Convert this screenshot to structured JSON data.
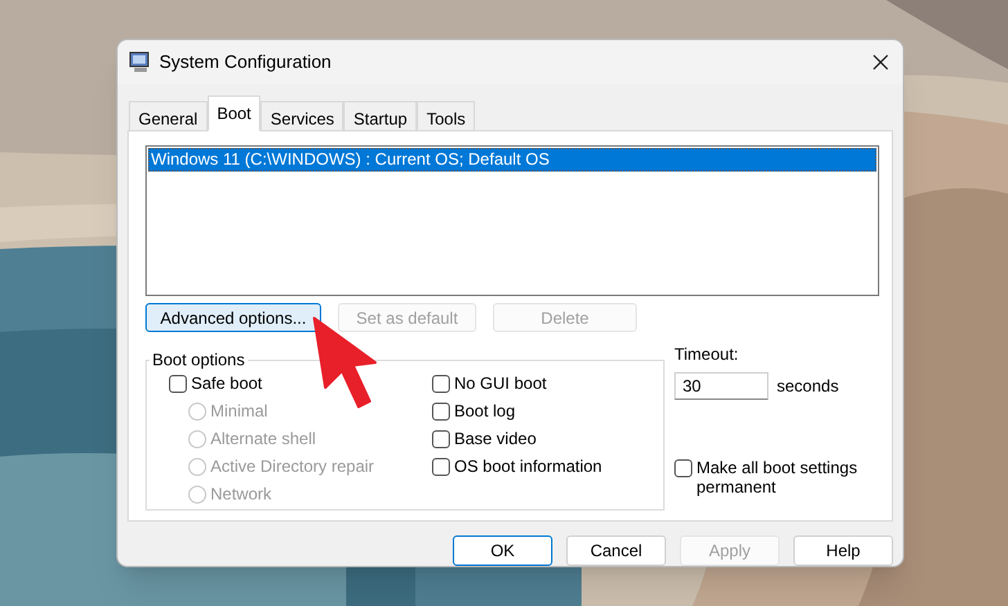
{
  "window": {
    "title": "System Configuration"
  },
  "tabs": [
    {
      "label": "General",
      "selected": false
    },
    {
      "label": "Boot",
      "selected": true
    },
    {
      "label": "Services",
      "selected": false
    },
    {
      "label": "Startup",
      "selected": false
    },
    {
      "label": "Tools",
      "selected": false
    }
  ],
  "boot_entries": [
    {
      "label": "Windows 11 (C:\\WINDOWS) : Current OS; Default OS",
      "selected": true
    }
  ],
  "entry_buttons": [
    {
      "label": "Advanced options...",
      "disabled": false
    },
    {
      "label": "Set as default",
      "disabled": true
    },
    {
      "label": "Delete",
      "disabled": true
    }
  ],
  "boot_options": {
    "title": "Boot options",
    "safe_boot": {
      "label": "Safe boot",
      "checked": false
    },
    "safe_modes": [
      {
        "label": "Minimal",
        "selected": false,
        "disabled": true
      },
      {
        "label": "Alternate shell",
        "selected": false,
        "disabled": true
      },
      {
        "label": "Active Directory repair",
        "selected": false,
        "disabled": true
      },
      {
        "label": "Network",
        "selected": false,
        "disabled": true
      }
    ],
    "flags": [
      {
        "label": "No GUI boot",
        "checked": false
      },
      {
        "label": "Boot log",
        "checked": false
      },
      {
        "label": "Base video",
        "checked": false
      },
      {
        "label": "OS boot information",
        "checked": false
      }
    ]
  },
  "timeout": {
    "label": "Timeout:",
    "value": "30",
    "unit": "seconds"
  },
  "permanent": {
    "label": "Make all boot settings permanent",
    "checked": false
  },
  "footer_buttons": [
    {
      "label": "OK",
      "disabled": false,
      "default": true
    },
    {
      "label": "Cancel",
      "disabled": false,
      "default": false
    },
    {
      "label": "Apply",
      "disabled": true,
      "default": false
    },
    {
      "label": "Help",
      "disabled": false,
      "default": false
    }
  ]
}
